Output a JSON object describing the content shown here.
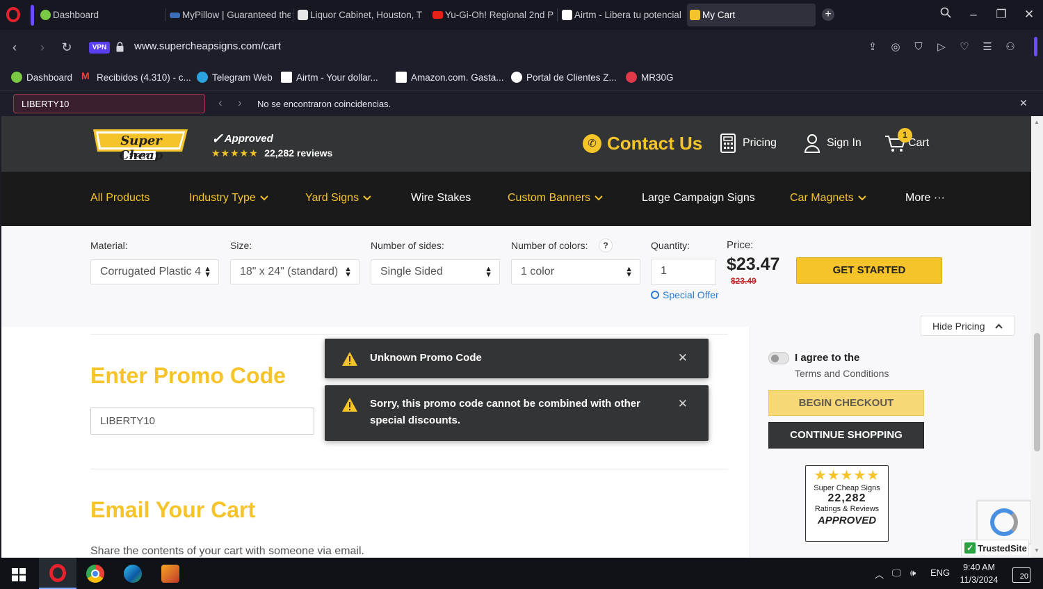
{
  "browser": {
    "tabs": [
      {
        "label": "Dashboard",
        "color": "#7ac943"
      },
      {
        "label": "MyPillow | Guaranteed the",
        "color": "#3a6db5"
      },
      {
        "label": "Liquor Cabinet, Houston, T",
        "color": "#d8d8d8"
      },
      {
        "label": "Yu-Gi-Oh! Regional 2nd P",
        "color": "#e62117"
      },
      {
        "label": "Airtm - Libera tu potencial",
        "color": "#ffffff"
      },
      {
        "label": "My Cart",
        "color": "#f5c32a"
      }
    ],
    "new_tab": "+",
    "url": "www.supercheapsigns.com/cart",
    "vpn_label": "VPN",
    "bookmarks": [
      {
        "label": "Dashboard",
        "color": "#7ac943"
      },
      {
        "label": "Recibidos (4.310) - c...",
        "color": "#ea4335"
      },
      {
        "label": "Telegram Web",
        "color": "#2aa3df"
      },
      {
        "label": "Airtm - Your dollar...",
        "color": "#ffffff"
      },
      {
        "label": "Amazon.com. Gasta...",
        "color": "#ffffff"
      },
      {
        "label": "Portal de Clientes Z...",
        "color": "#ffffff"
      },
      {
        "label": "MR30G",
        "color": "#e03a4a"
      }
    ],
    "find": {
      "query": "LIBERTY10",
      "message": "No se encontraron coincidencias."
    }
  },
  "site": {
    "approved": {
      "word": "Approved",
      "stars": "★★★★★",
      "reviews": "22,282 reviews"
    },
    "logo_text": "Super Cheap",
    "logo_sub": "SIGNS",
    "contact": "Contact Us",
    "pricing": "Pricing",
    "sign_in": "Sign In",
    "cart": "Cart",
    "cart_count": "1",
    "nav": [
      {
        "label": "All Products",
        "dropdown": false
      },
      {
        "label": "Industry Type",
        "dropdown": true
      },
      {
        "label": "Yard Signs",
        "dropdown": true
      },
      {
        "label": "Wire Stakes",
        "dropdown": false
      },
      {
        "label": "Custom Banners",
        "dropdown": true
      },
      {
        "label": "Large Campaign Signs",
        "dropdown": false
      },
      {
        "label": "Car Magnets",
        "dropdown": true
      },
      {
        "label": "More ···",
        "dropdown": false
      }
    ],
    "configurator": {
      "material_label": "Material:",
      "material_value": "Corrugated Plastic 4",
      "size_label": "Size:",
      "size_value": "18\" x 24\" (standard)",
      "sides_label": "Number of sides:",
      "sides_value": "Single Sided",
      "colors_label": "Number of colors:",
      "colors_help": "?",
      "colors_value": "1 color",
      "quantity_label": "Quantity:",
      "quantity_value": "1",
      "special_offer": "Special Offer",
      "price_label": "Price:",
      "price": "$23.47",
      "price_was": "$23.49",
      "get_started": "GET STARTED",
      "hide_pricing": "Hide Pricing"
    },
    "promo": {
      "title": "Enter Promo Code",
      "code": "LIBERTY10"
    },
    "email": {
      "title": "Email Your Cart",
      "text": "Share the contents of your cart with someone via email."
    },
    "sidebar": {
      "agree": "I agree to the",
      "terms": "Terms and Conditions",
      "begin_checkout": "BEGIN CHECKOUT",
      "continue_shopping": "CONTINUE SHOPPING",
      "badge": {
        "stars": "★★★★★",
        "name": "Super Cheap Signs",
        "count": "22,282",
        "sub": "Ratings & Reviews",
        "approved": "APPROVED"
      },
      "trusted": "TrustedSite"
    },
    "toasts": [
      {
        "text": "Unknown Promo Code"
      },
      {
        "text": "Sorry, this promo code cannot be combined with other special discounts."
      }
    ]
  },
  "taskbar": {
    "language": "ENG",
    "time": "9:40 AM",
    "date": "11/3/2024",
    "notifications": "20"
  },
  "colors": {
    "brand_yellow": "#f5c32a",
    "header_dark": "#333435",
    "nav_dark": "#1a1a1a"
  }
}
